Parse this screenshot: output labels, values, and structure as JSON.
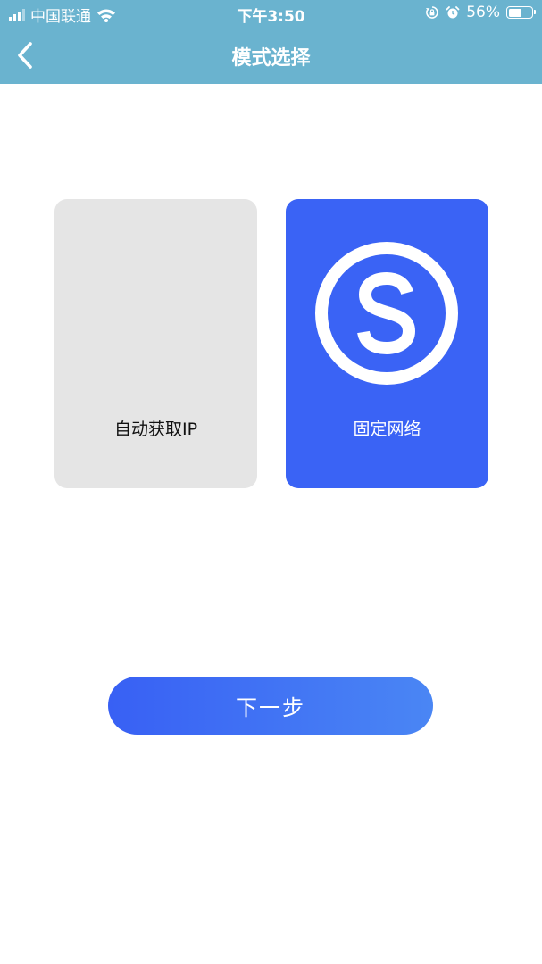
{
  "status_bar": {
    "carrier": "中国联通",
    "time": "下午3:50",
    "battery_percent": "56%",
    "battery_level": 0.56,
    "icons": [
      "signal-icon",
      "wifi-icon",
      "orientation-lock-icon",
      "alarm-icon",
      "battery-icon"
    ]
  },
  "nav": {
    "title": "模式选择",
    "back_icon": "chevron-left-icon"
  },
  "modes": {
    "auto": {
      "label": "自动获取IP",
      "selected": false
    },
    "fixed": {
      "label": "固定网络",
      "selected": true,
      "icon": "s-circle-icon"
    }
  },
  "actions": {
    "next_label": "下一步"
  },
  "colors": {
    "header_bg": "#6ab3cf",
    "selected_card": "#3a63f5",
    "unselected_card": "#e5e5e5",
    "button_gradient_start": "#3860f4",
    "button_gradient_end": "#4a86f4"
  }
}
